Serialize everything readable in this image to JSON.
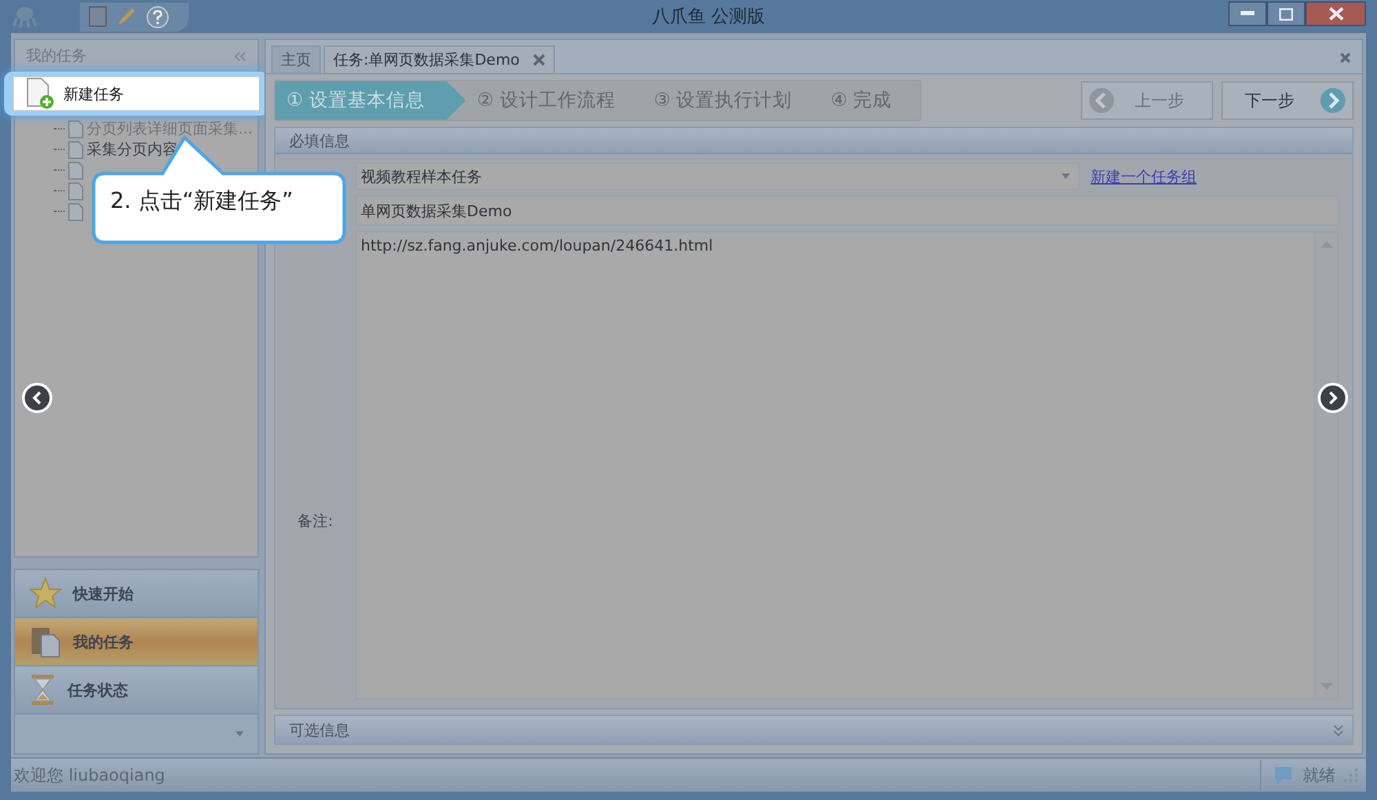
{
  "window": {
    "title": "八爪鱼 公测版"
  },
  "sidebar": {
    "title": "我的任务",
    "new_task_button": "新建任务",
    "tree": [
      {
        "kind": "document",
        "label": "分页列表详细页面采集..."
      },
      {
        "kind": "document",
        "label": "采集分页内容"
      },
      {
        "kind": "document"
      },
      {
        "kind": "document"
      },
      {
        "kind": "document"
      }
    ],
    "nav": [
      {
        "kind": "star",
        "label": "快速开始",
        "selected": false
      },
      {
        "kind": "tasks",
        "label": "我的任务",
        "selected": true
      },
      {
        "kind": "hourglass",
        "label": "任务状态",
        "selected": false
      }
    ]
  },
  "tabs": [
    {
      "label": "主页",
      "selected": false,
      "closable": false
    },
    {
      "label": "任务:单网页数据采集Demo",
      "selected": true,
      "closable": true
    }
  ],
  "steps": [
    {
      "label": "① 设置基本信息",
      "selected": true
    },
    {
      "label": "② 设计工作流程",
      "selected": false
    },
    {
      "label": "③ 设置执行计划",
      "selected": false
    },
    {
      "label": "④ 完成",
      "selected": false
    }
  ],
  "prev_button": {
    "label": "上一步",
    "disabled": true
  },
  "next_button": {
    "label": "下一步",
    "disabled": false
  },
  "required_section": {
    "title": "必填信息",
    "group": "视频教程样本任务",
    "new_group_link": "新建一个任务组",
    "name": "单网页数据采集Demo",
    "url": "http://sz.fang.anjuke.com/loupan/246641.html",
    "remark_label": "备注:"
  },
  "optional_section": {
    "title": "可选信息"
  },
  "status_bar": {
    "welcome": "欢迎您 liubaoqiang",
    "state": "就绪"
  },
  "tutorial": {
    "callout": "2. 点击“新建任务”"
  }
}
